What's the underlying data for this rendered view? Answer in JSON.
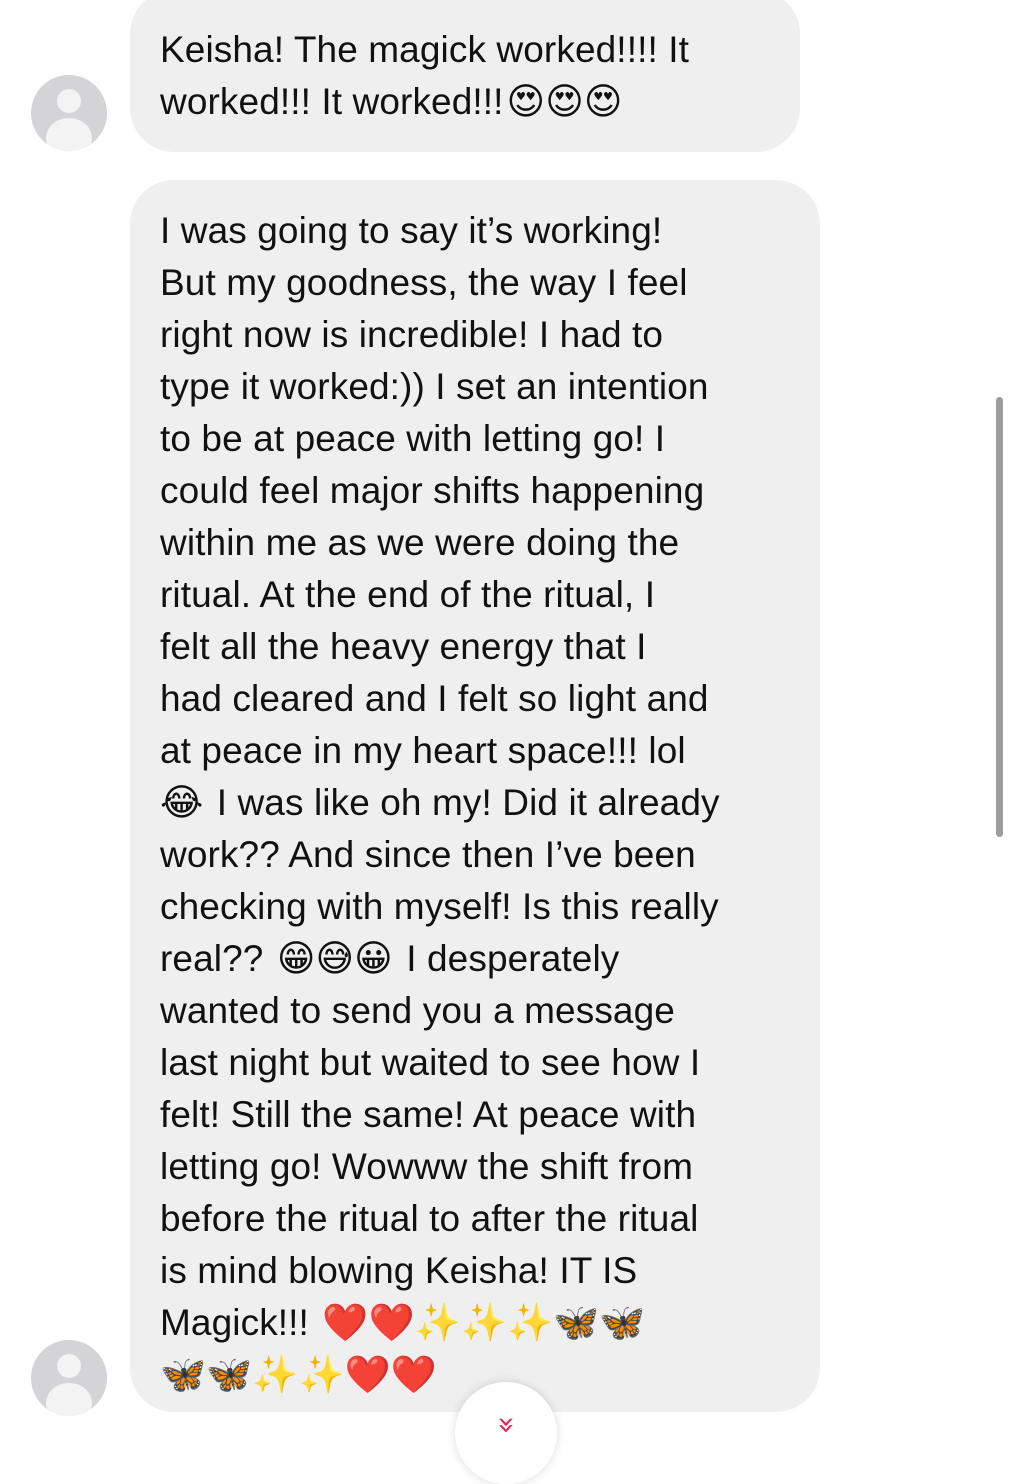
{
  "messages": [
    {
      "lines": [
        {
          "text": "Keisha! The magick worked!!!! It",
          "emoji": ""
        },
        {
          "text": "worked!!! It worked!!!",
          "emoji": "😍😍😍"
        }
      ]
    },
    {
      "lines": [
        {
          "text": "I was going to say it’s working!",
          "emoji": ""
        },
        {
          "text": "But my goodness, the way I feel",
          "emoji": ""
        },
        {
          "text": "right now is incredible! I had to",
          "emoji": ""
        },
        {
          "text": "type it worked:)) I set an intention",
          "emoji": ""
        },
        {
          "text": "to be at peace with letting go! I",
          "emoji": ""
        },
        {
          "text": "could feel major shifts happening",
          "emoji": ""
        },
        {
          "text": "within me as we were doing the",
          "emoji": ""
        },
        {
          "text": "ritual. At the end of the ritual, I",
          "emoji": ""
        },
        {
          "text": "felt all the heavy energy that I",
          "emoji": ""
        },
        {
          "text": "had cleared and I felt so light and",
          "emoji": ""
        },
        {
          "text": "at peace in my heart space!!! lol",
          "emoji": ""
        },
        {
          "emoji_lead": "😂",
          "text": " I was like oh my! Did it already",
          "emoji": ""
        },
        {
          "text": "work?? And since then I’ve been",
          "emoji": ""
        },
        {
          "text": "checking with myself! Is this really",
          "emoji": ""
        },
        {
          "text": "real?? ",
          "emoji": "😁😅😀",
          "text_after": " I desperately"
        },
        {
          "text": "wanted to send you a message",
          "emoji": ""
        },
        {
          "text": "last night but waited to see how I",
          "emoji": ""
        },
        {
          "text": "felt! Still the same! At peace with",
          "emoji": ""
        },
        {
          "text": "letting go! Wowww the shift from",
          "emoji": ""
        },
        {
          "text": "before the ritual to after the ritual",
          "emoji": ""
        },
        {
          "text": "is mind blowing Keisha! IT IS",
          "emoji": ""
        },
        {
          "text": "Magick!!! ",
          "emoji": "❤️❤️✨✨✨🦋🦋"
        },
        {
          "text": "",
          "emoji": "🦋🦋✨✨❤️❤️"
        }
      ]
    }
  ],
  "scroll_button": {
    "icon": "»"
  }
}
